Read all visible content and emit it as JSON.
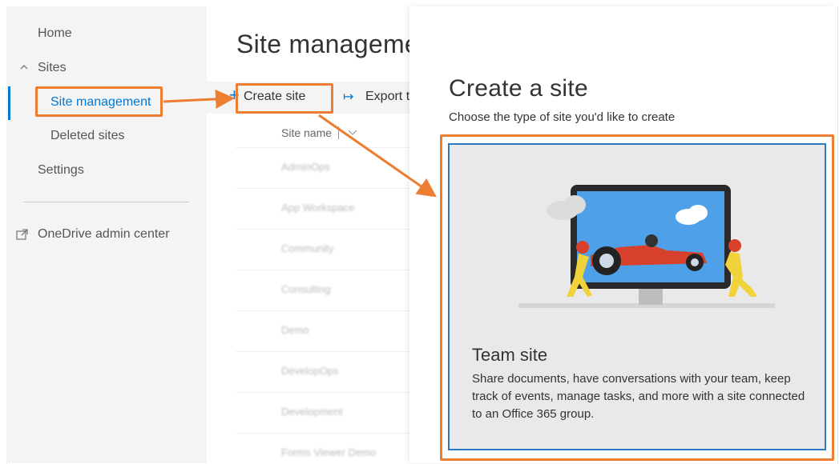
{
  "nav": {
    "home": "Home",
    "sites": "Sites",
    "site_management": "Site management",
    "deleted_sites": "Deleted sites",
    "settings": "Settings",
    "onedrive": "OneDrive admin center"
  },
  "main": {
    "title": "Site manageme",
    "toolbar": {
      "create_site": "Create site",
      "export": "Export t"
    },
    "column_header": "Site name",
    "rows": [
      "AdminOps",
      "App Workspace",
      "Community",
      "Consulting",
      "Demo",
      "DevelopOps",
      "Development",
      "Forms Viewer Demo"
    ]
  },
  "panel": {
    "title": "Create a site",
    "subtitle": "Choose the type of site you'd like to create",
    "card": {
      "title": "Team site",
      "description": "Share documents, have conversations with your team, keep track of events, manage tasks, and more with a site connected to an Office 365 group."
    }
  },
  "colors": {
    "accent": "#0078d4",
    "callout": "#ed7d31",
    "card_border": "#2b79c2"
  },
  "icons": [
    "chevron-up-icon",
    "external-link-icon",
    "plus-icon",
    "export-arrow-icon",
    "chevron-down-icon"
  ]
}
